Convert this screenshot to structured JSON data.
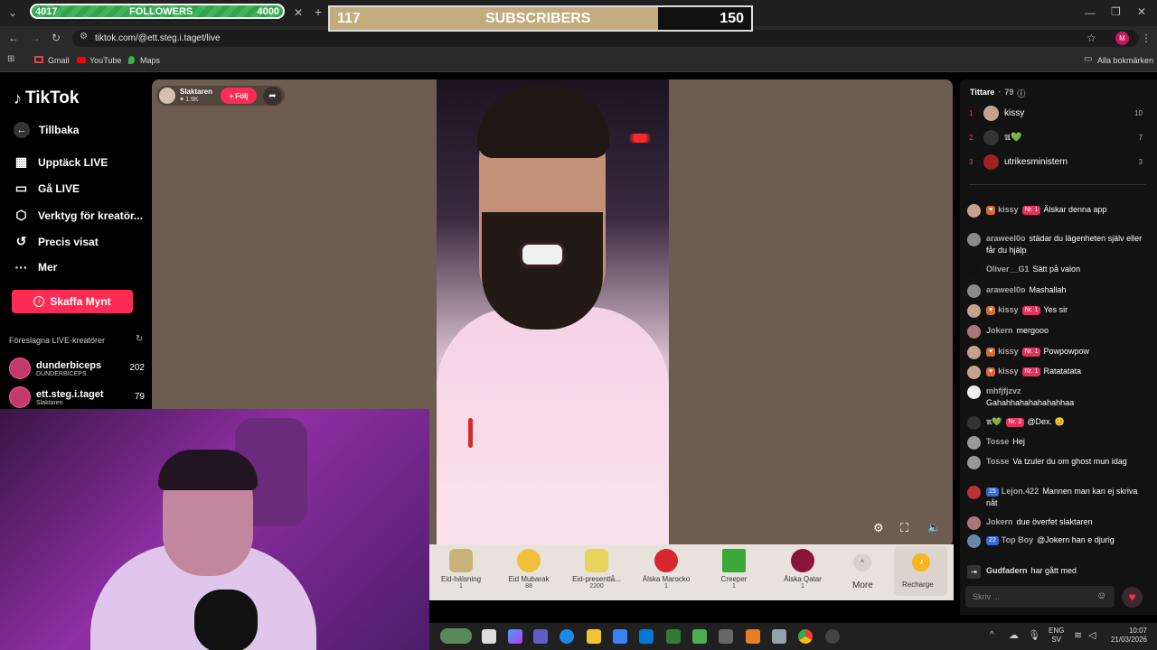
{
  "browser": {
    "followers_left": "4017",
    "followers_label": "FOLLOWERS",
    "followers_right": "4000",
    "url": "tiktok.com/@ett.steg.i.taget/live",
    "bookmarks": [
      "Gmail",
      "YouTube",
      "Maps"
    ],
    "all_bookmarks": "Alla bokmärken",
    "profile_initial": "M"
  },
  "subs_overlay": {
    "left": "117",
    "label": "SUBSCRIBERS",
    "right": "150",
    "fill_fraction": 0.78
  },
  "sidebar": {
    "logo": "TikTok",
    "back": "Tillbaka",
    "items": [
      "Upptäck LIVE",
      "Gå LIVE",
      "Verktyg för kreatör...",
      "Precis visat",
      "Mer"
    ],
    "coins_button": "Skaffa Mynt",
    "suggested_title": "Föreslagna LIVE-kreatörer",
    "creators": [
      {
        "name": "dunderbiceps",
        "sub": "DUNDERBICEPS",
        "count": "202"
      },
      {
        "name": "ett.steg.i.taget",
        "sub": "Slaktaren",
        "count": "79"
      }
    ]
  },
  "stream": {
    "host_name": "Slaktaren",
    "host_likes": "1.9K",
    "follow_label": "Följ"
  },
  "gifts": [
    {
      "name": "Eid-hälsning",
      "cost": "1"
    },
    {
      "name": "Eid Mubarak",
      "cost": "88"
    },
    {
      "name": "Eid-presentlå...",
      "cost": "2200"
    },
    {
      "name": "Älska Marocko",
      "cost": "1"
    },
    {
      "name": "Creeper",
      "cost": "1"
    },
    {
      "name": "Älska Qatar",
      "cost": "1"
    }
  ],
  "gift_more": "More",
  "recharge": "Recharge",
  "chat": {
    "viewers_title": "Tittare",
    "viewers_count": "79",
    "top_viewers": [
      {
        "rank": "1",
        "name": "kissy",
        "score": "10"
      },
      {
        "rank": "2",
        "name": "ℼ💚",
        "score": "7"
      },
      {
        "rank": "3",
        "name": "utrikesministern",
        "score": "3"
      }
    ],
    "messages": [
      {
        "user": "kissy",
        "badge": "Nr. 1",
        "text": "Älskar denna app"
      },
      {
        "user": "araweel0o",
        "badge": "",
        "text": "städar du lägenheten själv eller får du hjälp"
      },
      {
        "user": "Oliver__G1",
        "badge": "",
        "text": "Sätt på valon"
      },
      {
        "user": "araweel0o",
        "badge": "",
        "text": "Mashallah"
      },
      {
        "user": "kissy",
        "badge": "Nr. 1",
        "text": "Yes sir"
      },
      {
        "user": "Jokern",
        "badge": "",
        "text": "mergooo"
      },
      {
        "user": "kissy",
        "badge": "Nr. 1",
        "text": "Powpowpow"
      },
      {
        "user": "kissy",
        "badge": "Nr. 1",
        "text": "Ratatatata"
      },
      {
        "user": "mhfjfjzvz",
        "badge": "",
        "text": "Gahahhahahahahahhaa"
      },
      {
        "user": "ℼ💚",
        "badge": "Nr. 2",
        "text": "@Dex. 😊"
      },
      {
        "user": "Tosse",
        "badge": "",
        "text": "Hej"
      },
      {
        "user": "Tosse",
        "badge": "",
        "text": "Va tzuler du om ghost mun idag"
      },
      {
        "user": "Lejon.422",
        "badge": "15",
        "text": "Mannen man kan ej skriva nåt"
      },
      {
        "user": "Jokern",
        "badge": "",
        "text": "due överfet slaktaren"
      },
      {
        "user": "Top Boy",
        "badge": "22",
        "text": "@Jokern han e djurig"
      },
      {
        "user": "Gudfadern",
        "badge": "",
        "text": "har gått med"
      }
    ],
    "input_placeholder": "Skriv ..."
  },
  "taskbar": {
    "lang": "ENG",
    "lang2": "SV",
    "time": "10:07",
    "date": "21/03/2026"
  }
}
